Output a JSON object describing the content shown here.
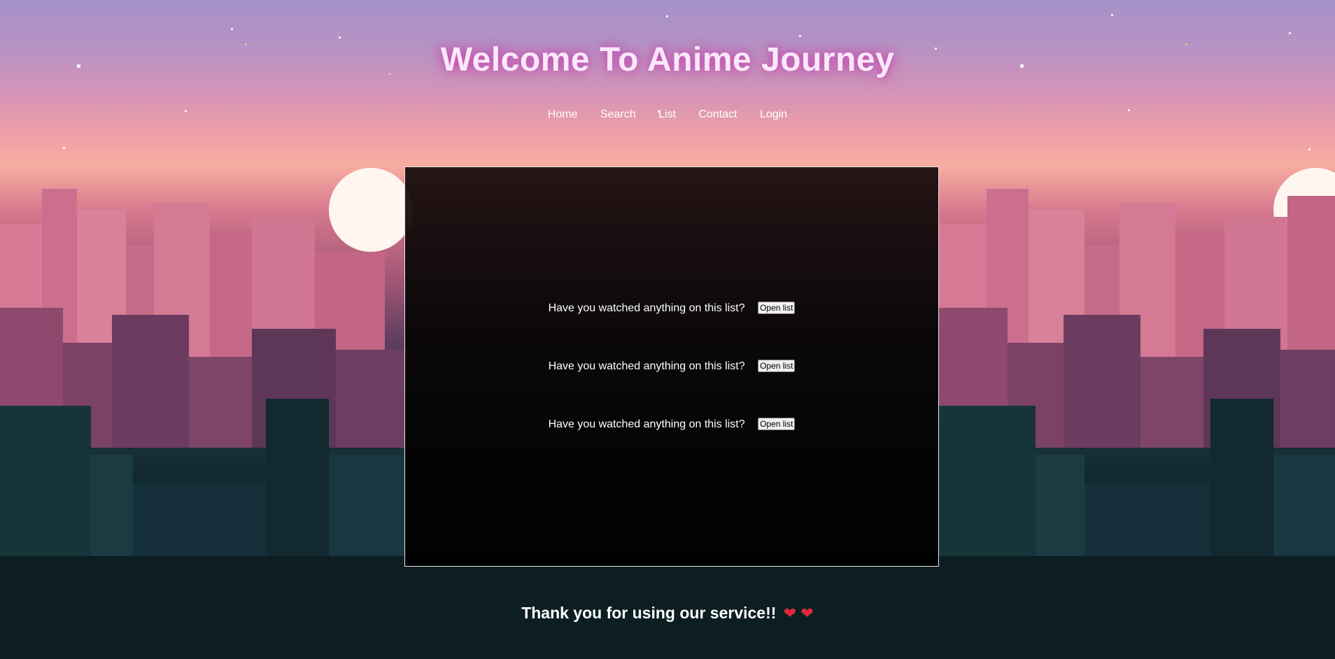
{
  "header": {
    "title": "Welcome To Anime Journey"
  },
  "nav": {
    "items": [
      "Home",
      "Search",
      "List",
      "Contact",
      "Login"
    ]
  },
  "panel": {
    "rows": [
      {
        "question": "Have you watched anything on this list?",
        "button": "Open list"
      },
      {
        "question": "Have you watched anything on this list?",
        "button": "Open list"
      },
      {
        "question": "Have you watched anything on this list?",
        "button": "Open list"
      }
    ]
  },
  "footer": {
    "message": "Thank you for using our service!!",
    "emoji": "❤ ❤"
  },
  "colors": {
    "title": "#fbe7fb",
    "title_glow": "#c73caa",
    "panel_bg": "#000000",
    "panel_border": "#e9e2e6",
    "heart": "#e0283c"
  }
}
